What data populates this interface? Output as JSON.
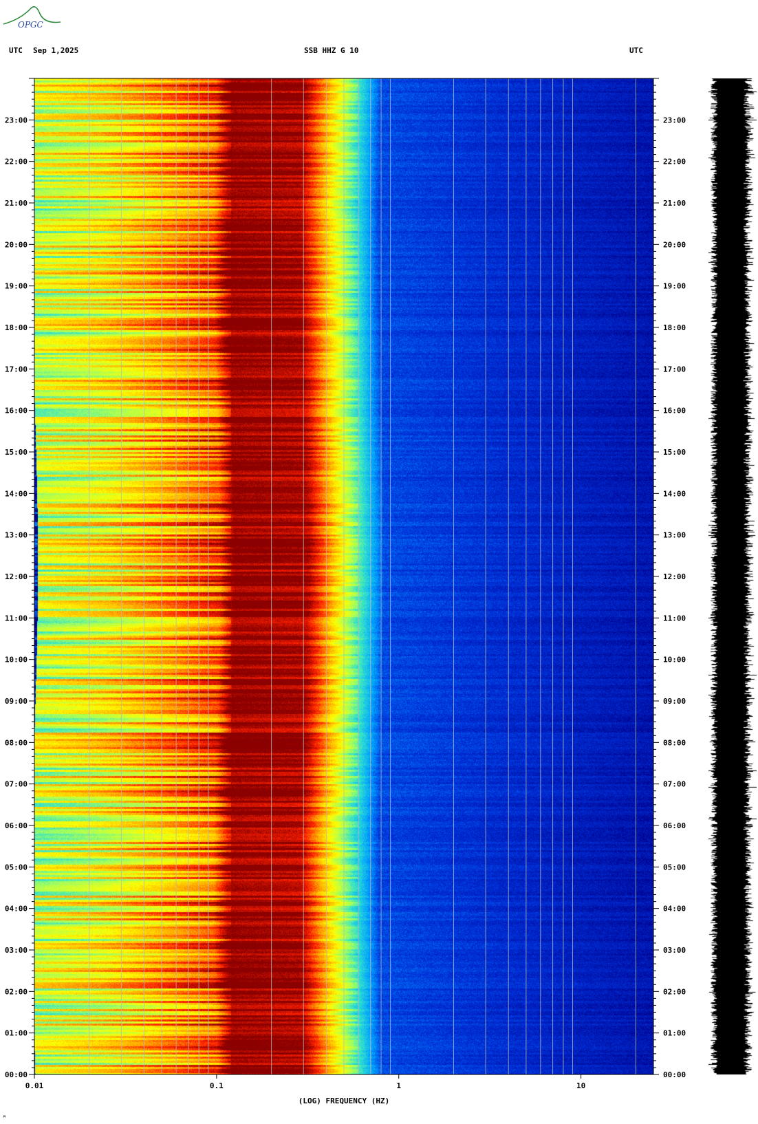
{
  "header": {
    "left_label": "UTC",
    "date": "Sep 1,2025",
    "station": "SSB HHZ G 10",
    "right_label": "UTC"
  },
  "logo": {
    "text": "OPGC"
  },
  "footer": {
    "mark": "ᴹ"
  },
  "chart_data": {
    "type": "heatmap",
    "title": "SSB HHZ G 10",
    "xlabel": "(LOG) FREQUENCY (HZ)",
    "x_scale": "log",
    "xlim": [
      0.01,
      25
    ],
    "x_ticks": [
      "0.01",
      "0.1",
      "1",
      "10"
    ],
    "ylabel": "UTC",
    "ylim_hours": [
      0,
      24
    ],
    "y_ticks": [
      "00:00",
      "01:00",
      "02:00",
      "03:00",
      "04:00",
      "05:00",
      "06:00",
      "07:00",
      "08:00",
      "09:00",
      "10:00",
      "11:00",
      "12:00",
      "13:00",
      "14:00",
      "15:00",
      "16:00",
      "17:00",
      "18:00",
      "19:00",
      "20:00",
      "21:00",
      "22:00",
      "23:00"
    ],
    "colormap": [
      "#00008b",
      "#0033dd",
      "#00a0ff",
      "#30e0d0",
      "#a0ff60",
      "#ffff00",
      "#ffa500",
      "#ff2000",
      "#8b0000"
    ],
    "power_profile": [
      {
        "freq": 0.01,
        "level": 0.55
      },
      {
        "freq": 0.024,
        "level": 0.62
      },
      {
        "freq": 0.05,
        "level": 0.72
      },
      {
        "freq": 0.1,
        "level": 0.82
      },
      {
        "freq": 0.12,
        "level": 1.0
      },
      {
        "freq": 0.3,
        "level": 0.97
      },
      {
        "freq": 0.5,
        "level": 0.55
      },
      {
        "freq": 0.8,
        "level": 0.15
      },
      {
        "freq": 25,
        "level": 0.05
      }
    ],
    "grid_lines_hz": [
      0.02,
      0.03,
      0.04,
      0.05,
      0.06,
      0.07,
      0.08,
      0.09,
      0.2,
      0.3,
      0.4,
      0.5,
      0.6,
      0.7,
      0.8,
      0.9,
      2,
      3,
      4,
      5,
      6,
      7,
      8,
      9,
      20
    ],
    "grid": true,
    "seismogram": true
  }
}
